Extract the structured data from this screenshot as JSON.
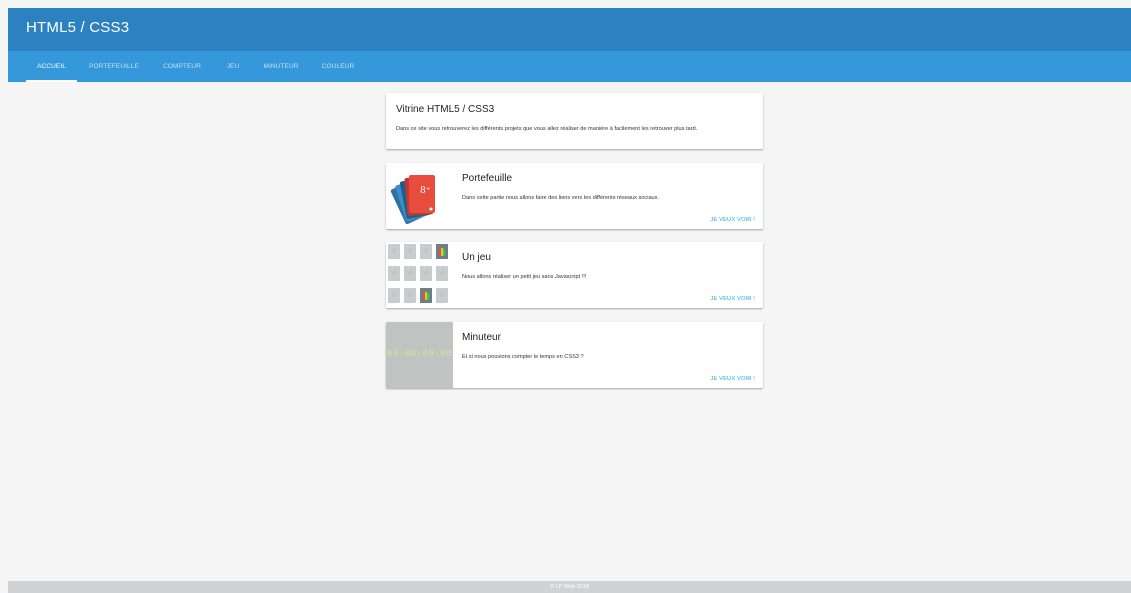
{
  "header": {
    "title": "HTML5 / CSS3"
  },
  "nav": {
    "tabs": [
      {
        "label": "ACCUEIL",
        "active": true
      },
      {
        "label": "PORTEFEUILLE",
        "active": false
      },
      {
        "label": "COMPTEUR",
        "active": false
      },
      {
        "label": "JEU",
        "active": false
      },
      {
        "label": "MINUTEUR",
        "active": false
      },
      {
        "label": "COULEUR",
        "active": false
      }
    ]
  },
  "intro": {
    "title": "Vitrine HTML5 / CSS3",
    "text": "Dans ce site vous retrouverez les différents projets que vous allez réaliser de manière à facilement les retrouver plus tard."
  },
  "cards": [
    {
      "title": "Portefeuille",
      "text": "Dans cette partie nous allons faire des liens vers les différents réseaux sociaux.",
      "action": "JE VEUX VOIR !",
      "thumb_icon": "social-cards-icon"
    },
    {
      "title": "Un jeu",
      "text": "Nous allons réaliser un petit jeu sans Javascript !!!",
      "action": "JE VEUX VOIR !",
      "thumb_icon": "memory-game-grid-icon"
    },
    {
      "title": "Minuteur",
      "text": "Et si nous pouvions compter le temps en CSS3 ?",
      "action": "JE VEUX VOIR !",
      "thumb_icon": "digital-timer-icon",
      "thumb_text": "00:00:00:00"
    }
  ],
  "footer": {
    "text": "© LP Web 2018"
  },
  "colors": {
    "header": "#2c82c0",
    "navbar": "#3498db",
    "action": "#26a9e0",
    "background": "#f5f5f5",
    "footer": "#cfd3d6"
  }
}
